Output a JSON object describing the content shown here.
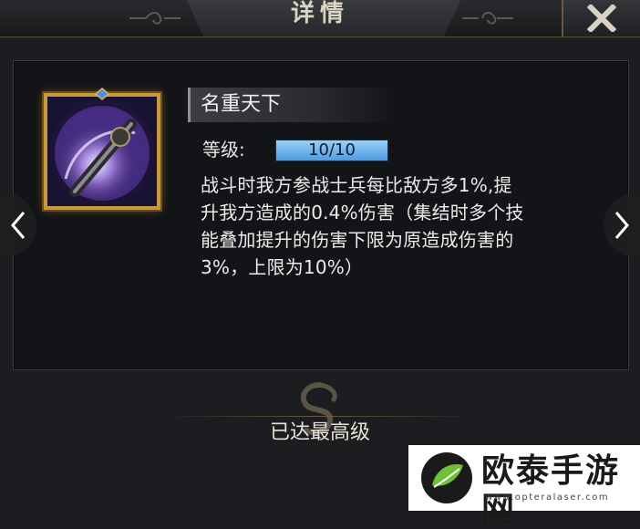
{
  "header": {
    "title": "详情",
    "close_icon": "close-icon"
  },
  "skill": {
    "name": "名重天下",
    "icon": "sword-skill-icon",
    "level_label": "等级:",
    "level_text": "10/10",
    "level_fraction": 1.0,
    "description_lines": [
      "战斗时我方参战士兵每比敌方多1%,提",
      "升我方造成的0.4%伤害（集结时多个技",
      "能叠加提升的伤害下限为原造成伤害的",
      "3%，上限为10%）"
    ]
  },
  "navigation": {
    "prev_icon": "chevron-left-icon",
    "next_icon": "chevron-right-icon"
  },
  "footer": {
    "status": "已达最高级",
    "emblem_icon": "dragon-emblem-icon"
  },
  "watermark": {
    "text": "欧泰手游网",
    "url": "www.opteralaser.com"
  },
  "colors": {
    "accent_gold": "#c99a3c",
    "level_bar": "#6fb3ec",
    "background": "#1c1d20"
  }
}
